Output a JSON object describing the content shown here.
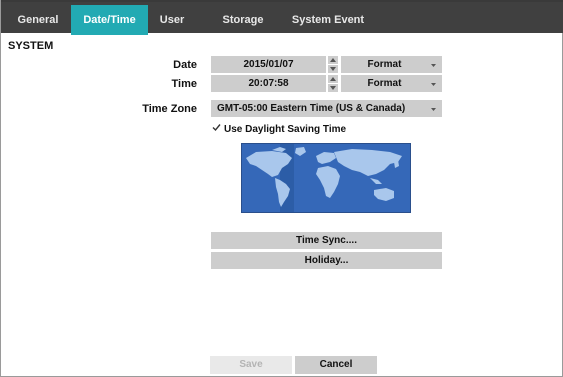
{
  "tabs": [
    {
      "label": "General"
    },
    {
      "label": "Date/Time",
      "active": true
    },
    {
      "label": "User"
    },
    {
      "label": "Storage"
    },
    {
      "label": "System Event"
    }
  ],
  "section_title": "SYSTEM",
  "date": {
    "label": "Date",
    "value": "2015/01/07",
    "format_label": "Format"
  },
  "time": {
    "label": "Time",
    "value": "20:07:58",
    "format_label": "Format"
  },
  "time_zone": {
    "label": "Time Zone",
    "value": "GMT-05:00   Eastern Time (US & Canada)"
  },
  "dst": {
    "label": "Use Daylight Saving Time",
    "checked": true
  },
  "map": {
    "icon": "world-map"
  },
  "buttons": {
    "time_sync": "Time Sync....",
    "holiday": "Holiday...",
    "save": "Save",
    "cancel": "Cancel"
  },
  "colors": {
    "tab_bar": "#404040",
    "active_tab": "#22aab3",
    "field_bg": "#cdcdcd",
    "map_bg": "#3568b8"
  }
}
